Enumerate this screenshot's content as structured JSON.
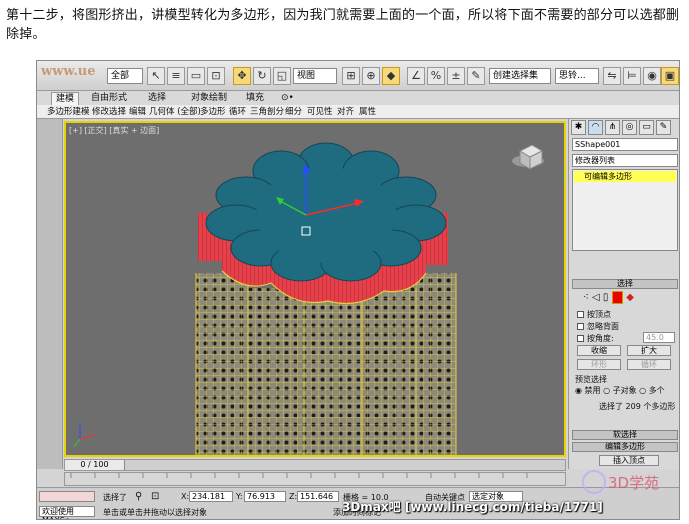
{
  "caption": "第十二步，将图形挤出，讲模型转化为多边形，因为我门就需要上面的一个面，所以将下面不需要的部分可以选都删除掉。",
  "toolbar": {
    "logo_text": "www.ue",
    "select_all": "全部",
    "view_select": "视图",
    "named_selection": "创建选择集",
    "more": "思铃..."
  },
  "ribbon": {
    "tabs": [
      "建模",
      "自由形式",
      "选择",
      "对象绘制",
      "填充",
      "⊙•"
    ],
    "active_tab": 0,
    "subitems": [
      "多边形建模",
      "修改选择",
      "编辑",
      "几何体 (全部)",
      "多边形",
      "循环",
      "三角剖分",
      "细分",
      "可见性",
      "对齐",
      "属性"
    ]
  },
  "viewport": {
    "label": "[+] [正交] [真实 + 边面]"
  },
  "command_panel": {
    "object_name": "SShape001",
    "modifier_list": "修改器列表",
    "stack_item": "可编辑多边形",
    "selection_rollout": "选择",
    "by_vertex": "按顶点",
    "ignore_backfacing": "忽略背面",
    "by_angle": "按角度:",
    "angle_value": "45.0",
    "shrink": "收缩",
    "grow": "扩大",
    "ring": "环形",
    "loop": "循环",
    "preview_selection": "预览选择",
    "preview_options": [
      "禁用",
      "子对象",
      "多个"
    ],
    "selected_count": "选择了 209 个多边形",
    "soft_selection": "软选择",
    "edit_polygons": "编辑多边形",
    "insert_vertex": "插入顶点",
    "extrude": "挤出",
    "outline": "轮廓"
  },
  "timeline": {
    "frame": "0 / 100",
    "ticks": [
      "0",
      "10",
      "15",
      "20",
      "25",
      "30",
      "35",
      "40",
      "45",
      "50",
      "55",
      "60",
      "65",
      "70",
      "75",
      "80",
      "85",
      "90",
      "95",
      "100"
    ]
  },
  "statusbar": {
    "selected": "选择了",
    "x_label": "X:",
    "x_value": "234.181",
    "y_label": "Y:",
    "y_value": "76.913",
    "z_label": "Z:",
    "z_value": "151.646",
    "grid": "栅格 = 10.0",
    "autokey": "自动关键点",
    "selected_obj": "选定对象",
    "set_key": "设置关键点",
    "key_filter": "关键点过滤器...",
    "add_time_tag": "添加时间标记",
    "welcome": "欢迎使用 MAXSc",
    "hint": "单击或单击并拖动以选择对象"
  },
  "watermark": "3Dmax吧 [www.linecg.com/tieba/1771]",
  "logo_text": "3D学苑",
  "colors": {
    "cap": "#1f6b7f",
    "walls": "#e8404a",
    "wire": "#e6cf3a",
    "viewport_bg": "#6e6e6e",
    "accent": "#ffff55"
  }
}
